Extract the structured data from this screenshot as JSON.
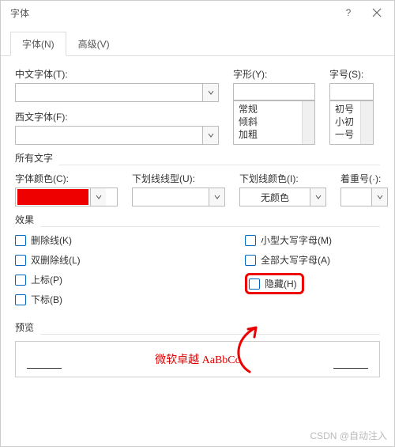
{
  "title": "字体",
  "titlebar": {
    "help_icon": "?",
    "close_icon": "×"
  },
  "tabs": {
    "font": "字体(N)",
    "advanced": "高级(V)"
  },
  "labels": {
    "cnFont": "中文字体(T):",
    "enFont": "西文字体(F):",
    "style": "字形(Y):",
    "size": "字号(S):",
    "allText": "所有文字",
    "fontColor": "字体颜色(C):",
    "ulStyle": "下划线线型(U):",
    "ulColor": "下划线颜色(I):",
    "emphasis": "着重号(·):",
    "effects": "效果",
    "preview": "预览"
  },
  "styleList": [
    "常规",
    "倾斜",
    "加粗"
  ],
  "sizeList": [
    "初号",
    "小初",
    "一号"
  ],
  "values": {
    "cnFont": "",
    "enFont": "",
    "ulColor": "无颜色",
    "fontColorSwatch": "#e00000"
  },
  "effects": {
    "strike": "删除线(K)",
    "dblStrike": "双删除线(L)",
    "superscript": "上标(P)",
    "subscript": "下标(B)",
    "smallCaps": "小型大写字母(M)",
    "allCaps": "全部大写字母(A)",
    "hidden": "隐藏(H)"
  },
  "previewText": "微软卓越  AaBbCc",
  "watermark": "CSDN @自动注入"
}
